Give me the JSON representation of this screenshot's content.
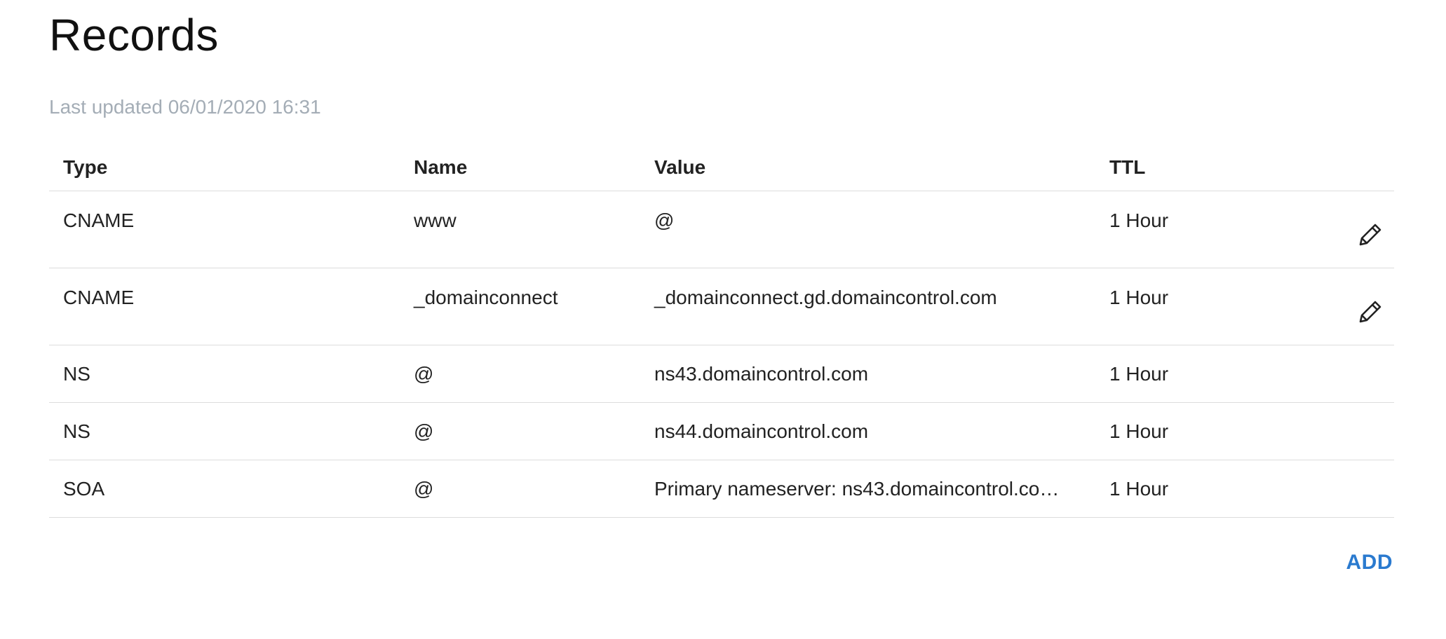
{
  "page": {
    "title": "Records",
    "last_updated": "Last updated 06/01/2020 16:31"
  },
  "table": {
    "headers": {
      "type": "Type",
      "name": "Name",
      "value": "Value",
      "ttl": "TTL"
    },
    "rows": [
      {
        "type": "CNAME",
        "name": "www",
        "value": "@",
        "ttl": "1 Hour",
        "editable": true
      },
      {
        "type": "CNAME",
        "name": "_domainconnect",
        "value": "_domainconnect.gd.domaincontrol.com",
        "ttl": "1 Hour",
        "editable": true
      },
      {
        "type": "NS",
        "name": "@",
        "value": "ns43.domaincontrol.com",
        "ttl": "1 Hour",
        "editable": false
      },
      {
        "type": "NS",
        "name": "@",
        "value": "ns44.domaincontrol.com",
        "ttl": "1 Hour",
        "editable": false
      },
      {
        "type": "SOA",
        "name": "@",
        "value": "Primary nameserver: ns43.domaincontrol.co…",
        "ttl": "1 Hour",
        "editable": false
      }
    ]
  },
  "actions": {
    "add_label": "ADD"
  },
  "icons": {
    "edit": "pencil-icon"
  },
  "colors": {
    "accent": "#2a7acf",
    "muted_text": "#a4adb6",
    "divider": "#dcdcdc"
  }
}
